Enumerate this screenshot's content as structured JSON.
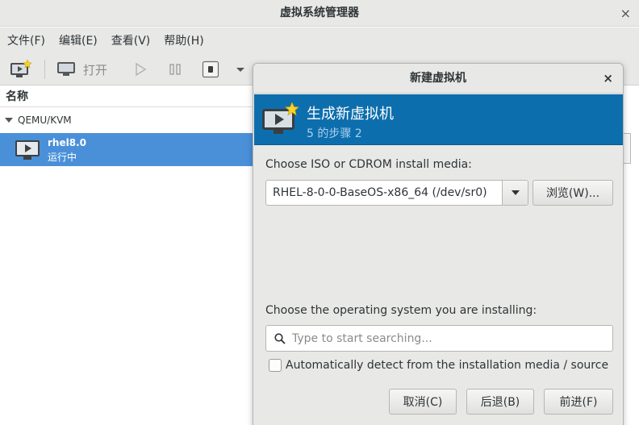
{
  "main_window": {
    "title": "虚拟系统管理器",
    "close": "×",
    "menu": [
      "文件(F)",
      "编辑(E)",
      "查看(V)",
      "帮助(H)"
    ],
    "toolbar": {
      "open_label": "打开"
    },
    "list_header": "名称",
    "group": "QEMU/KVM",
    "vm": {
      "name": "rhel8.0",
      "status": "运行中"
    }
  },
  "dialog": {
    "title": "新建虚拟机",
    "close": "×",
    "banner_title": "生成新虚拟机",
    "banner_step": "5 的步骤 2",
    "media_label": "Choose ISO or CDROM install media:",
    "media_value": "RHEL-8-0-0-BaseOS-x86_64 (/dev/sr0)",
    "browse_button": "浏览(W)...",
    "os_label": "Choose the operating system you are installing:",
    "search_placeholder": "Type to start searching...",
    "auto_detect_label": "Automatically detect from the installation media / source",
    "auto_detect_checked": false,
    "cancel_button": "取消(C)",
    "back_button": "后退(B)",
    "forward_button": "前进(F)"
  },
  "colors": {
    "banner": "#0d6ead",
    "selection": "#4a90d9",
    "window_bg": "#e8e8e7"
  },
  "icons": [
    "new-vm-icon",
    "monitor-icon",
    "play-icon",
    "pause-icon",
    "stop-icon",
    "dropdown-icon",
    "vm-icon",
    "search-icon",
    "close-icon"
  ]
}
